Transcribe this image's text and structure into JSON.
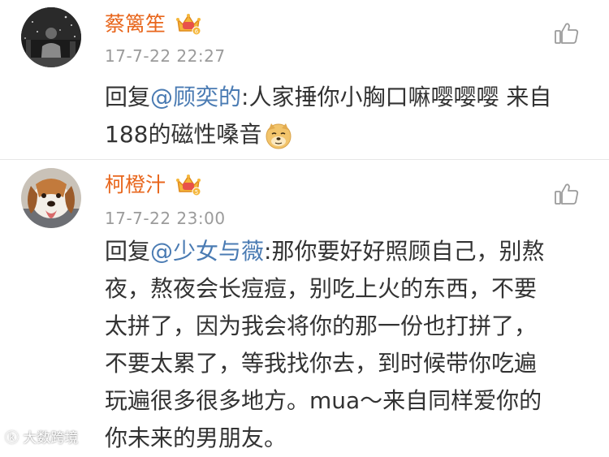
{
  "comments": [
    {
      "author": "蔡篱笙",
      "time": "17-7-22 22:27",
      "reply_prefix": "回复",
      "mention": "@顾奕的",
      "lines": [
        ":人家捶你小胸口嘛嘤嘤嘤 来自",
        "188的磁性嗓音"
      ],
      "emoji": "doge-emoji"
    },
    {
      "author": "柯橙汁",
      "time": "17-7-22 23:00",
      "reply_prefix": "回复",
      "mention": "@少女与薇",
      "lines": [
        ":那你要好好照顾自己，别熬",
        "夜，熬夜会长痘痘，别吃上火的东西，不要",
        "太拼了，因为我会将你的那一份也打拼了，",
        "不要太累了，等我找你去，到时候带你吃遍",
        "玩遍很多很多地方。mua～来自同样爱你的",
        "你未来的男朋友。"
      ]
    }
  ],
  "watermark": "大数跨境",
  "colors": {
    "name": "#e8661c",
    "mention": "#4a7bb3",
    "time": "#9b9b9b",
    "text": "#333333"
  },
  "icons": {
    "vip": "crown-vip-icon",
    "like": "thumbs-up-icon"
  }
}
